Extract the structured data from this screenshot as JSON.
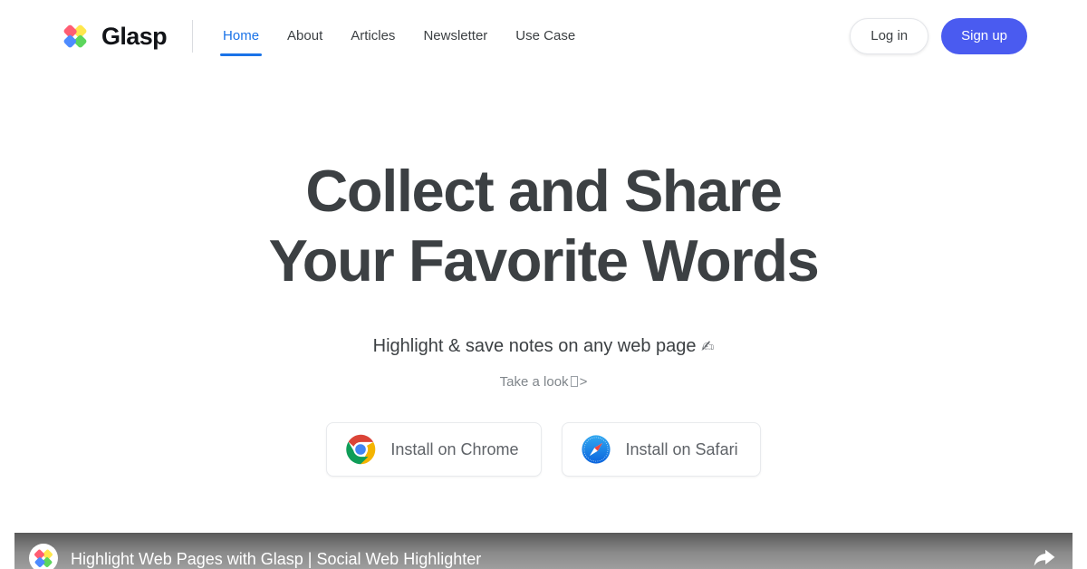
{
  "theme": {
    "accent_blue": "#1a73e8",
    "signup_blue": "#4a5bf0",
    "text_dark": "#3c4043",
    "muted": "#80868b",
    "background": "#ffffff"
  },
  "header": {
    "brand_name": "Glasp",
    "logo_icon": "glasp-diamond-logo",
    "nav": [
      {
        "label": "Home",
        "active": true
      },
      {
        "label": "About",
        "active": false
      },
      {
        "label": "Articles",
        "active": false
      },
      {
        "label": "Newsletter",
        "active": false
      },
      {
        "label": "Use Case",
        "active": false
      }
    ],
    "login_label": "Log in",
    "signup_label": "Sign up"
  },
  "hero": {
    "title_line1": "Collect and Share",
    "title_line2": "Your Favorite Words",
    "subtitle": "Highlight & save notes on any web page",
    "subtitle_icon": "✍",
    "look_prefix": "Take a look",
    "look_suffix": ">",
    "cta": [
      {
        "label": "Install on Chrome",
        "icon": "chrome-icon"
      },
      {
        "label": "Install on Safari",
        "icon": "safari-icon"
      }
    ]
  },
  "video": {
    "title": "Highlight Web Pages with Glasp | Social Web Highlighter",
    "avatar_icon": "glasp-channel-avatar",
    "share_icon": "share-icon"
  }
}
